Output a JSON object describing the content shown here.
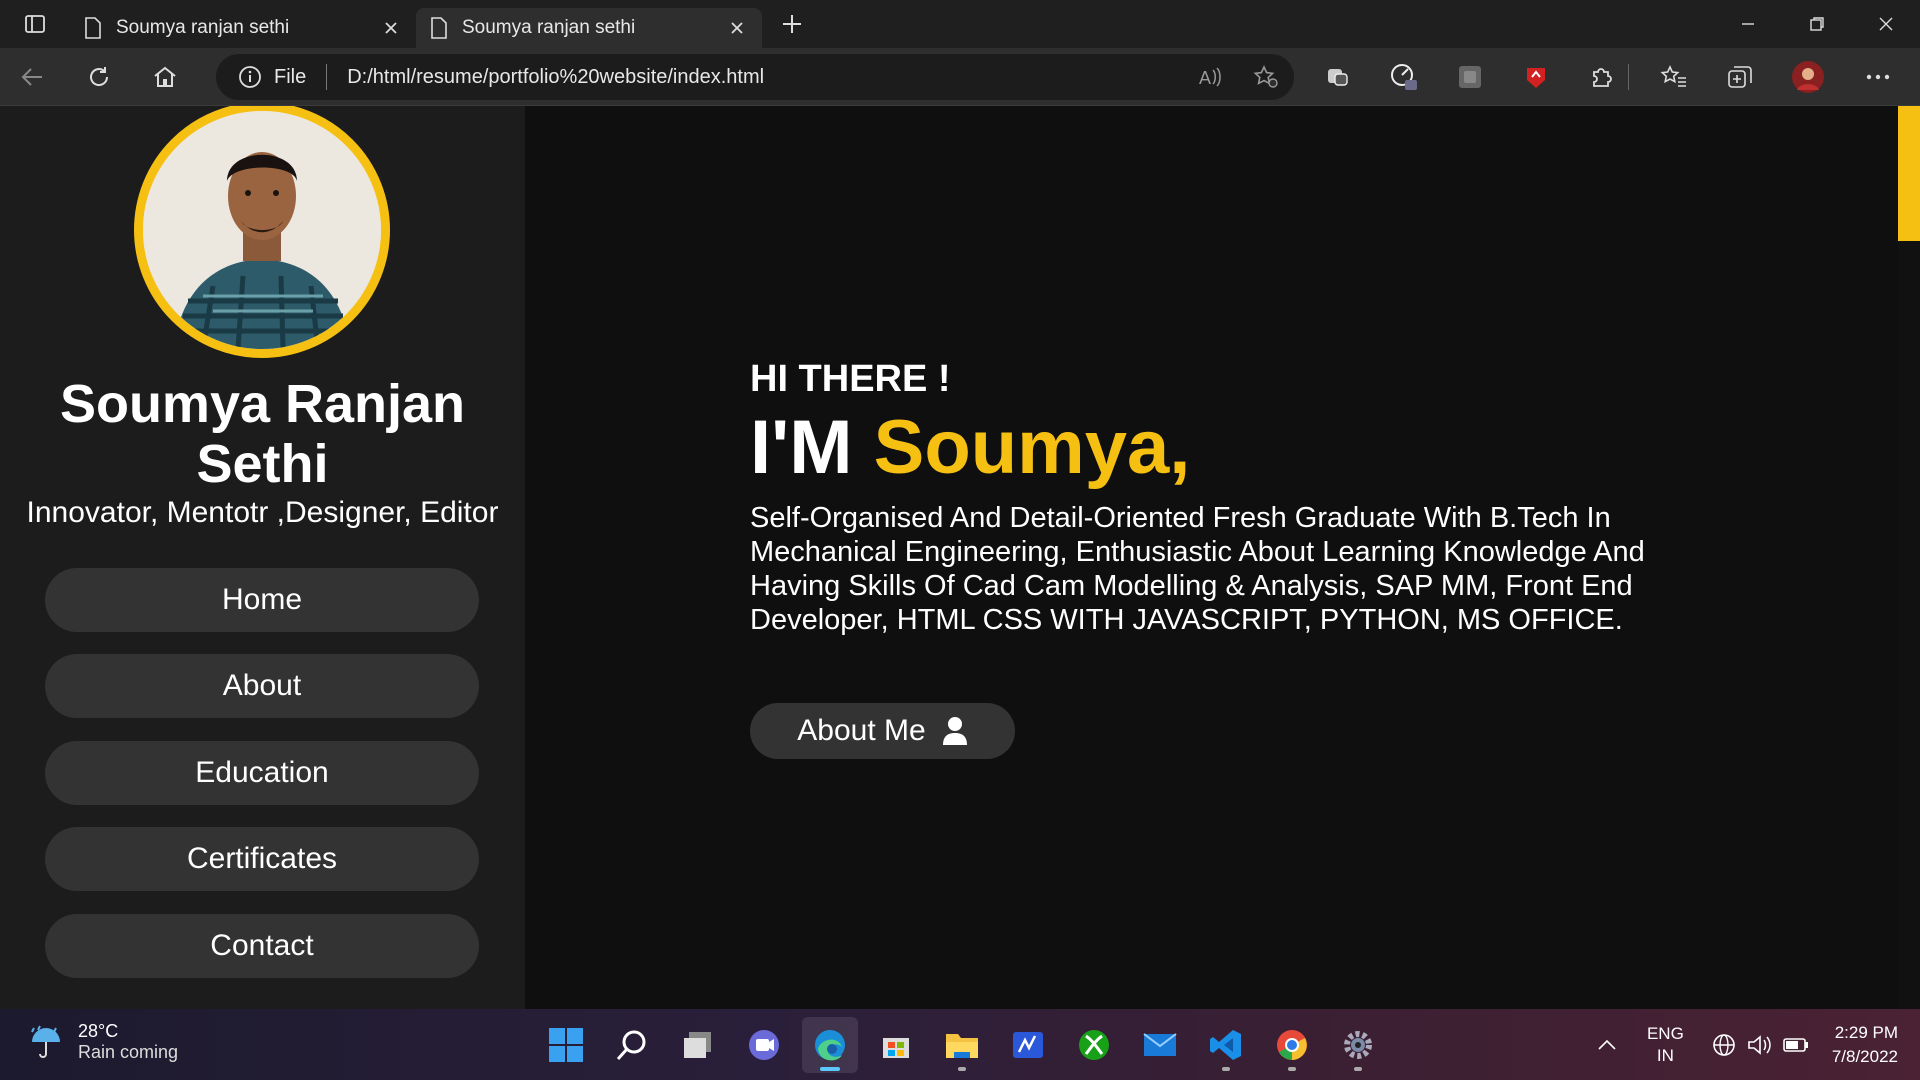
{
  "browser": {
    "tabs": [
      {
        "title": "Soumya ranjan sethi",
        "active": false
      },
      {
        "title": "Soumya ranjan sethi",
        "active": true
      }
    ],
    "address": {
      "scheme_label": "File",
      "url": "D:/html/resume/portfolio%20website/index.html"
    }
  },
  "sidebar": {
    "name": "Soumya Ranjan Sethi",
    "roles": "Innovator, Mentotr ,Designer, Editor",
    "nav": [
      "Home",
      "About",
      "Education",
      "Certificates",
      "Contact"
    ]
  },
  "hero": {
    "greeting": "HI THERE !",
    "headline_prefix": "I'M",
    "headline_name": "Soumya,",
    "bio": "Self-Organised And Detail-Oriented Fresh Graduate With B.Tech In Mechanical Engineering, Enthusiastic About Learning Knowledge And Having Skills Of Cad Cam Modelling & Analysis, SAP MM, Front End Developer, HTML CSS WITH JAVASCRIPT, PYTHON, MS OFFICE.",
    "button_label": "About Me",
    "accent_color": "#f6c013"
  },
  "taskbar": {
    "weather_temp": "28°C",
    "weather_cond": "Rain coming",
    "lang_top": "ENG",
    "lang_bottom": "IN",
    "time": "2:29 PM",
    "date": "7/8/2022"
  }
}
